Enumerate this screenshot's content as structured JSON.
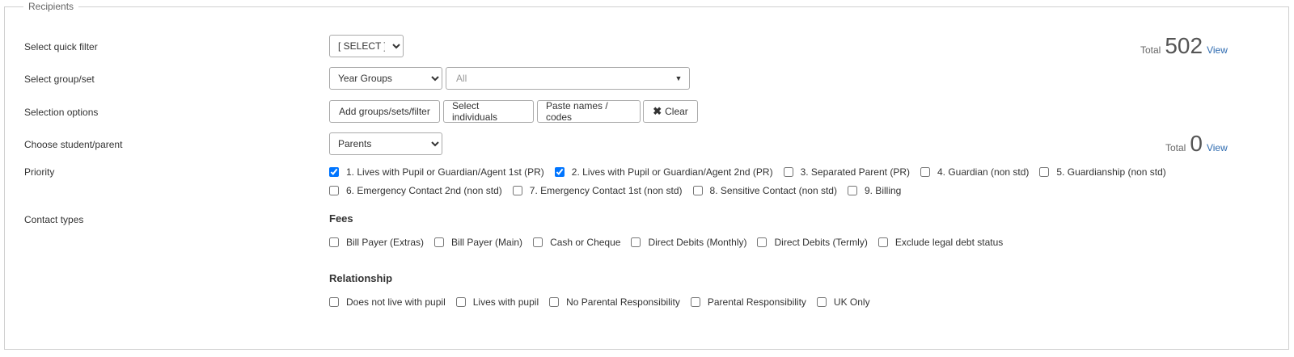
{
  "legend": "Recipients",
  "rows": {
    "quick_filter": {
      "label": "Select quick filter",
      "value": "[ SELECT ]"
    },
    "group_set": {
      "label": "Select group/set",
      "value": "Year Groups",
      "input_placeholder": "All"
    },
    "selection_options": {
      "label": "Selection options",
      "buttons": {
        "add": "Add groups/sets/filter",
        "select_individuals": "Select individuals",
        "paste": "Paste names / codes",
        "clear": "Clear"
      }
    },
    "student_parent": {
      "label": "Choose student/parent",
      "value": "Parents"
    },
    "priority": {
      "label": "Priority",
      "options": [
        {
          "label": "1. Lives with Pupil or Guardian/Agent 1st (PR)",
          "checked": true
        },
        {
          "label": "2. Lives with Pupil or Guardian/Agent 2nd (PR)",
          "checked": true
        },
        {
          "label": "3. Separated Parent (PR)",
          "checked": false
        },
        {
          "label": "4. Guardian (non std)",
          "checked": false
        },
        {
          "label": "5. Guardianship (non std)",
          "checked": false
        },
        {
          "label": "6. Emergency Contact 2nd (non std)",
          "checked": false
        },
        {
          "label": "7. Emergency Contact 1st (non std)",
          "checked": false
        },
        {
          "label": "8. Sensitive Contact (non std)",
          "checked": false
        },
        {
          "label": "9. Billing",
          "checked": false
        }
      ]
    },
    "contact_types": {
      "label": "Contact types",
      "fees_heading": "Fees",
      "fees": [
        "Bill Payer (Extras)",
        "Bill Payer (Main)",
        "Cash or Cheque",
        "Direct Debits (Monthly)",
        "Direct Debits (Termly)",
        "Exclude legal debt status"
      ],
      "relationship_heading": "Relationship",
      "relationship": [
        "Does not live with pupil",
        "Lives with pupil",
        "No Parental Responsibility",
        "Parental Responsibility",
        "UK Only"
      ]
    }
  },
  "totals": [
    {
      "label": "Total",
      "count": "502",
      "link": "View"
    },
    {
      "label": "Total",
      "count": "0",
      "link": "View"
    }
  ],
  "colors": {
    "link": "#2e6bb0",
    "border": "#aaaaaa"
  }
}
